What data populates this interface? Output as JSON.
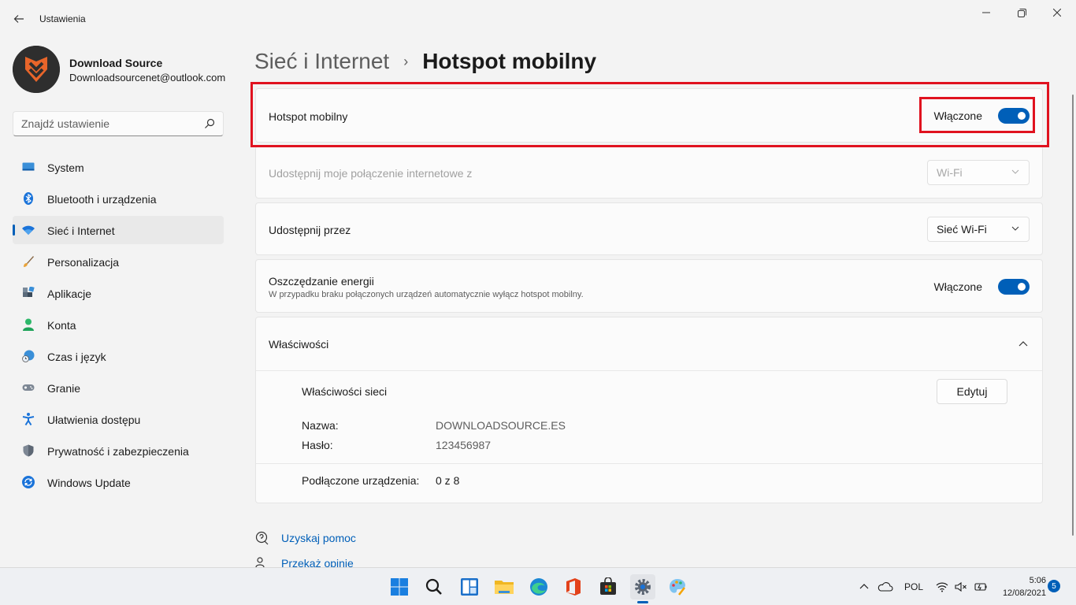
{
  "window": {
    "title": "Ustawienia",
    "back_icon": "arrow-left-icon",
    "controls": [
      "minimize-icon",
      "maximize-icon",
      "close-icon"
    ]
  },
  "profile": {
    "name": "Download Source",
    "email": "Downloadsourcenet@outlook.com"
  },
  "search": {
    "placeholder": "Znajdź ustawienie",
    "icon": "search-icon"
  },
  "sidebar": {
    "items": [
      {
        "label": "System",
        "icon": "system-icon",
        "active": false
      },
      {
        "label": "Bluetooth i urządzenia",
        "icon": "bluetooth-icon",
        "active": false
      },
      {
        "label": "Sieć i Internet",
        "icon": "network-icon",
        "active": true
      },
      {
        "label": "Personalizacja",
        "icon": "brush-icon",
        "active": false
      },
      {
        "label": "Aplikacje",
        "icon": "apps-icon",
        "active": false
      },
      {
        "label": "Konta",
        "icon": "account-icon",
        "active": false
      },
      {
        "label": "Czas i język",
        "icon": "time-language-icon",
        "active": false
      },
      {
        "label": "Granie",
        "icon": "gaming-icon",
        "active": false
      },
      {
        "label": "Ułatwienia dostępu",
        "icon": "accessibility-icon",
        "active": false
      },
      {
        "label": "Prywatność i zabezpieczenia",
        "icon": "shield-icon",
        "active": false
      },
      {
        "label": "Windows Update",
        "icon": "windows-update-icon",
        "active": false
      }
    ]
  },
  "breadcrumb": {
    "parent": "Sieć i Internet",
    "separator": "›",
    "current": "Hotspot mobilny"
  },
  "cards": {
    "hotspot": {
      "label": "Hotspot mobilny",
      "state": "Włączone",
      "on": true
    },
    "share_from": {
      "label": "Udostępnij moje połączenie internetowe z",
      "value": "Wi-Fi",
      "disabled": true
    },
    "share_over": {
      "label": "Udostępnij przez",
      "value": "Sieć Wi-Fi"
    },
    "power_saving": {
      "label": "Oszczędzanie energii",
      "description": "W przypadku braku połączonych urządzeń automatycznie wyłącz hotspot mobilny.",
      "state": "Włączone",
      "on": true
    },
    "properties": {
      "label": "Właściwości",
      "expanded_icon": "chevron-up-icon",
      "network_props_label": "Właściwości sieci",
      "edit_label": "Edytuj",
      "name_key": "Nazwa:",
      "name_value": "DOWNLOADSOURCE.ES",
      "password_key": "Hasło:",
      "password_value": "123456987",
      "connected_key": "Podłączone urządzenia:",
      "connected_value": "0 z 8"
    }
  },
  "help": {
    "get_help": "Uzyskaj pomoc",
    "feedback": "Przekaż opinię"
  },
  "taskbar": {
    "apps": [
      "windows-start-icon",
      "search-icon",
      "widgets-icon",
      "file-explorer-icon",
      "edge-icon",
      "office-icon",
      "store-icon",
      "settings-icon",
      "paint-icon"
    ],
    "tray_language": "POL",
    "time": "5:06",
    "date": "12/08/2021",
    "notifications": "5"
  },
  "colors": {
    "accent": "#005fb8",
    "highlight": "#e0121f"
  }
}
